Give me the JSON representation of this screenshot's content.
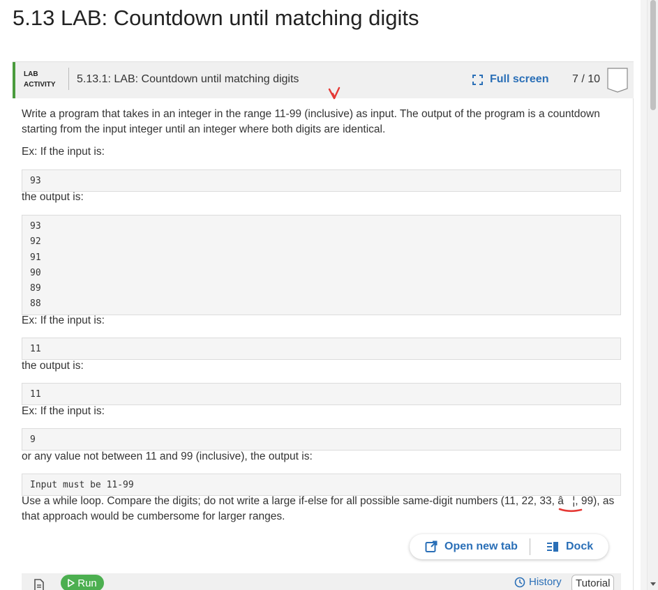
{
  "page": {
    "title": "5.13 LAB: Countdown until matching digits"
  },
  "lab_header": {
    "badge_line1": "LAB",
    "badge_line2": "ACTIVITY",
    "subtitle": "5.13.1: LAB: Countdown until matching digits",
    "fullscreen_label": "Full screen",
    "progress": "7 / 10",
    "accent_color": "#4a9b3d",
    "link_color": "#2a6fb7"
  },
  "content": {
    "intro_line1": "Write a program that takes in an integer in the range 11-99 (inclusive) as input. The output of the program is a countdown",
    "intro_line2": "starting from the input integer until an integer where both digits are identical.",
    "ex1_label": "Ex: If the input is:",
    "ex1_input": "93",
    "ex1_output_label": "the output is:",
    "ex1_output": [
      "93",
      "92",
      "91",
      "90",
      "89",
      "88"
    ],
    "ex2_label": "Ex: If the input is:",
    "ex2_input": "11",
    "ex2_output_label": "the output is:",
    "ex2_output": "11",
    "ex3_label": "Ex: If the input is:",
    "ex3_input": "9",
    "ex3_output_label": "or any value not between 11 and 99 (inclusive), the output is:",
    "ex3_output": "Input must be 11-99",
    "note_line1": "Use a while loop. Compare the digits; do not write a large if-else for all possible same-digit numbers (11, 22, 33, â¦, 99), as",
    "note_line2": "that approach would be cumbersome for larger ranges."
  },
  "actions": {
    "open_new_tab": "Open new tab",
    "dock": "Dock"
  },
  "bottom_bar": {
    "run": "Run",
    "history": "History",
    "tutorial": "Tutorial",
    "run_color": "#4caf50"
  },
  "icons": [
    "fullscreen-icon",
    "external-link-icon",
    "dock-icon",
    "file-icon",
    "play-icon",
    "history-icon"
  ]
}
